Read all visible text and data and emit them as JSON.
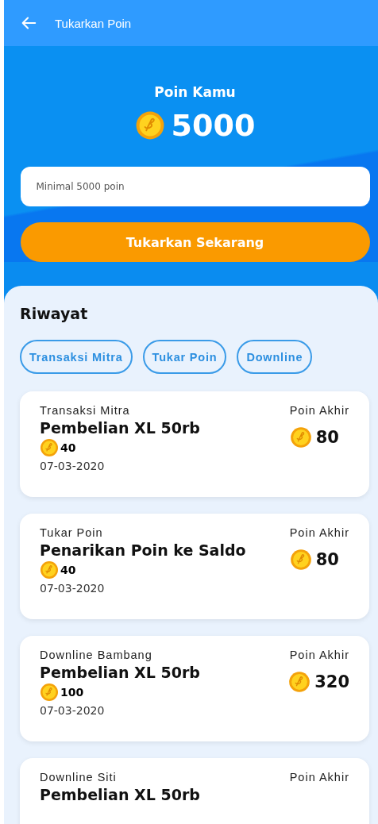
{
  "app_bar": {
    "title": "Tukarkan Poin"
  },
  "balance": {
    "label": "Poin Kamu",
    "points": "5000"
  },
  "redeem": {
    "placeholder": "Minimal 5000 poin",
    "button": "Tukarkan Sekarang"
  },
  "history": {
    "title": "Riwayat",
    "filters": [
      {
        "label": "Transaksi Mitra",
        "selected": false
      },
      {
        "label": "Tukar Poin",
        "selected": false
      },
      {
        "label": "Downline",
        "selected": false
      }
    ],
    "items": [
      {
        "category": "Transaksi Mitra",
        "title": "Pembelian XL 50rb",
        "points": "40",
        "date": "07-03-2020",
        "final_label": "Poin Akhir",
        "final_points": "80"
      },
      {
        "category": "Tukar Poin",
        "title": "Penarikan Poin ke Saldo",
        "points": "40",
        "date": "07-03-2020",
        "final_label": "Poin Akhir",
        "final_points": "80"
      },
      {
        "category": "Downline Bambang",
        "title": "Pembelian XL 50rb",
        "points": "100",
        "date": "07-03-2020",
        "final_label": "Poin Akhir",
        "final_points": "320"
      },
      {
        "category": "Downline Siti",
        "title": "Pembelian XL 50rb",
        "final_label": "Poin Akhir"
      }
    ]
  }
}
